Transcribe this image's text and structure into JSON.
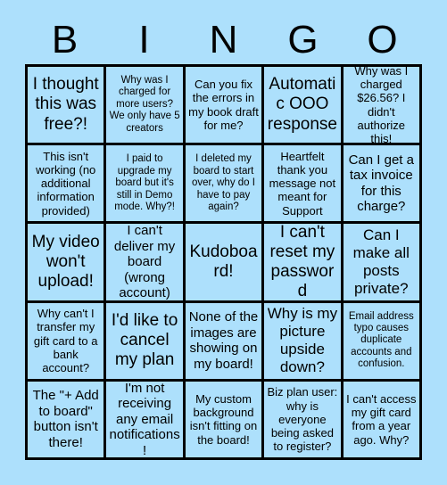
{
  "card": {
    "background_color": "#ade0fc",
    "text_color": "#000000",
    "border_color": "#000000",
    "header_letters": [
      "B",
      "I",
      "N",
      "G",
      "O"
    ],
    "free_space_index": 12,
    "columns": 5,
    "rows": 5,
    "cells": [
      "I thought this was free?!",
      "Why was I charged for more users? We only have 5 creators",
      "Can you fix the errors in my book draft for me?",
      "Automatic OOO response",
      "Why was I charged $26.56? I didn't authorize this!",
      "This isn't working (no additional information provided)",
      "I paid to upgrade my board but it's still in Demo mode. Why?!",
      "I deleted my board to start over, why do I have to pay again?",
      "Heartfelt thank you message not meant for Support",
      "Can I get a tax invoice for this charge?",
      "My video won't upload!",
      "I can't deliver my board (wrong account)",
      "Kudoboard!",
      "I can't reset my password",
      "Can I make all posts private?",
      "Why can't I transfer my gift card to a bank account?",
      "I'd like to cancel my plan",
      "None of the images are showing on my board!",
      "Why is my picture upside down?",
      "Email address typo causes duplicate accounts and confusion.",
      "The \"+ Add to board\" button isn't there!",
      "I'm not receiving any email notifications!",
      "My custom background isn't fitting on the board!",
      "Biz plan user: why is everyone being asked to register?",
      "I can't access my gift card from a year ago. Why?"
    ]
  }
}
